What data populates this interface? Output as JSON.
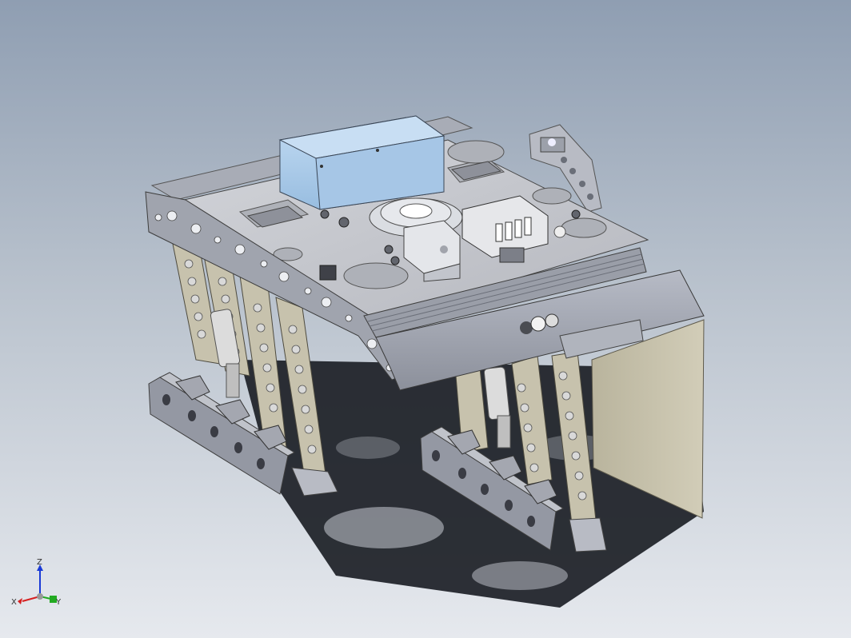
{
  "viewport": {
    "background_top": "#8f9eb2",
    "background_bottom": "#e6e9ee"
  },
  "model": {
    "frame_color": "#9ea3ae",
    "plate_color": "#c4c6cc",
    "enclosure_color": "#a9c8e6",
    "panel_color": "#c6c2ae",
    "shadow_color": "#1c1f26"
  },
  "triad": {
    "x_label": "X",
    "y_label": "Y",
    "z_label": "Z",
    "x_color": "#d62020",
    "y_color": "#22aa22",
    "z_color": "#1a3ad6"
  }
}
